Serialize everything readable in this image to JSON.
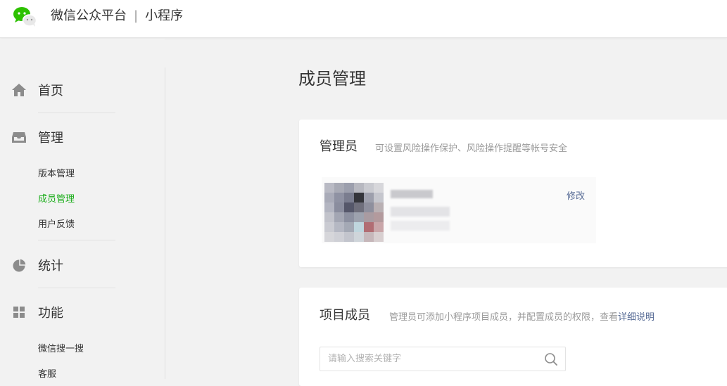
{
  "header": {
    "brand": "微信公众平台",
    "separator": "|",
    "product": "小程序"
  },
  "sidebar": {
    "groups": [
      {
        "label": "首页",
        "icon": "home-icon",
        "items": []
      },
      {
        "label": "管理",
        "icon": "inbox-icon",
        "items": [
          "版本管理",
          "成员管理",
          "用户反馈"
        ]
      },
      {
        "label": "统计",
        "icon": "pie-chart-icon",
        "items": []
      },
      {
        "label": "功能",
        "icon": "grid-icon",
        "items": [
          "微信搜一搜",
          "客服"
        ]
      }
    ],
    "active_item": "成员管理"
  },
  "main": {
    "title": "成员管理",
    "admin_card": {
      "title": "管理员",
      "desc": "可设置风险操作保护、风险操作提醒等帐号安全",
      "edit_label": "修改"
    },
    "members_card": {
      "title": "项目成员",
      "desc": "管理员可添加小程序项目成员，并配置成员的权限，查看",
      "desc_link": "详细说明",
      "search_placeholder": "请输入搜索关键字"
    }
  },
  "colors": {
    "accent_green": "#1aad19",
    "link_blue": "#576b95",
    "muted_text": "#9a9a9a",
    "page_bg": "#f2f2f2"
  }
}
